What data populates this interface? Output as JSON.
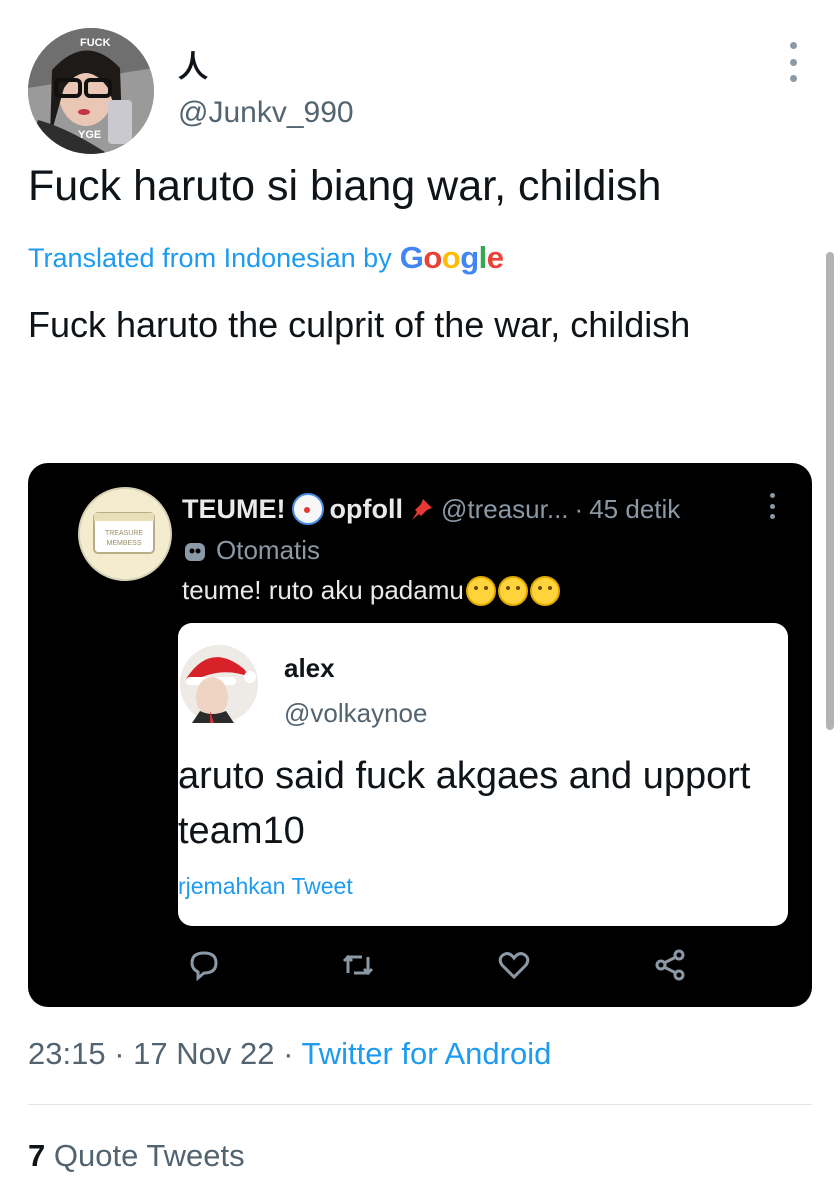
{
  "tweet": {
    "display_name": "人",
    "handle": "@Junkv_990",
    "avatar_text_top": "FUCK",
    "avatar_text_bottom": "YGE",
    "text": "Fuck haruto si biang war, childish",
    "translated_label": "Translated from Indonesian by",
    "google_letters": [
      "G",
      "o",
      "o",
      "g",
      "l",
      "e"
    ],
    "translation": "Fuck haruto the culprit of the war, childish",
    "time": "23:15",
    "date": "17 Nov 22",
    "source": "Twitter for Android",
    "quote_count": "7",
    "quote_label": "Quote Tweets"
  },
  "embedded": {
    "name": "TEUME!",
    "name_suffix": "opfoll",
    "handle": "@treasur...",
    "time_ago": "45 detik",
    "auto_label": "Otomatis",
    "text": "teume! ruto aku padamu",
    "avatar_text_1": "TREASURE",
    "avatar_text_2": "MEMBESS",
    "inner": {
      "name": "alex",
      "handle": "@volkaynoe",
      "text": "aruto said fuck akgaes and upport team10",
      "translate_label": "rjemahkan Tweet"
    },
    "action_icons": [
      "reply-icon",
      "retweet-icon",
      "like-icon",
      "share-icon"
    ]
  },
  "colors": {
    "accent": "#1d9bf0",
    "text_primary": "#0f1419",
    "text_secondary": "#536471",
    "google": [
      "#4285f4",
      "#ea4335",
      "#fbbc05",
      "#4285f4",
      "#34a853",
      "#ea4335"
    ]
  }
}
